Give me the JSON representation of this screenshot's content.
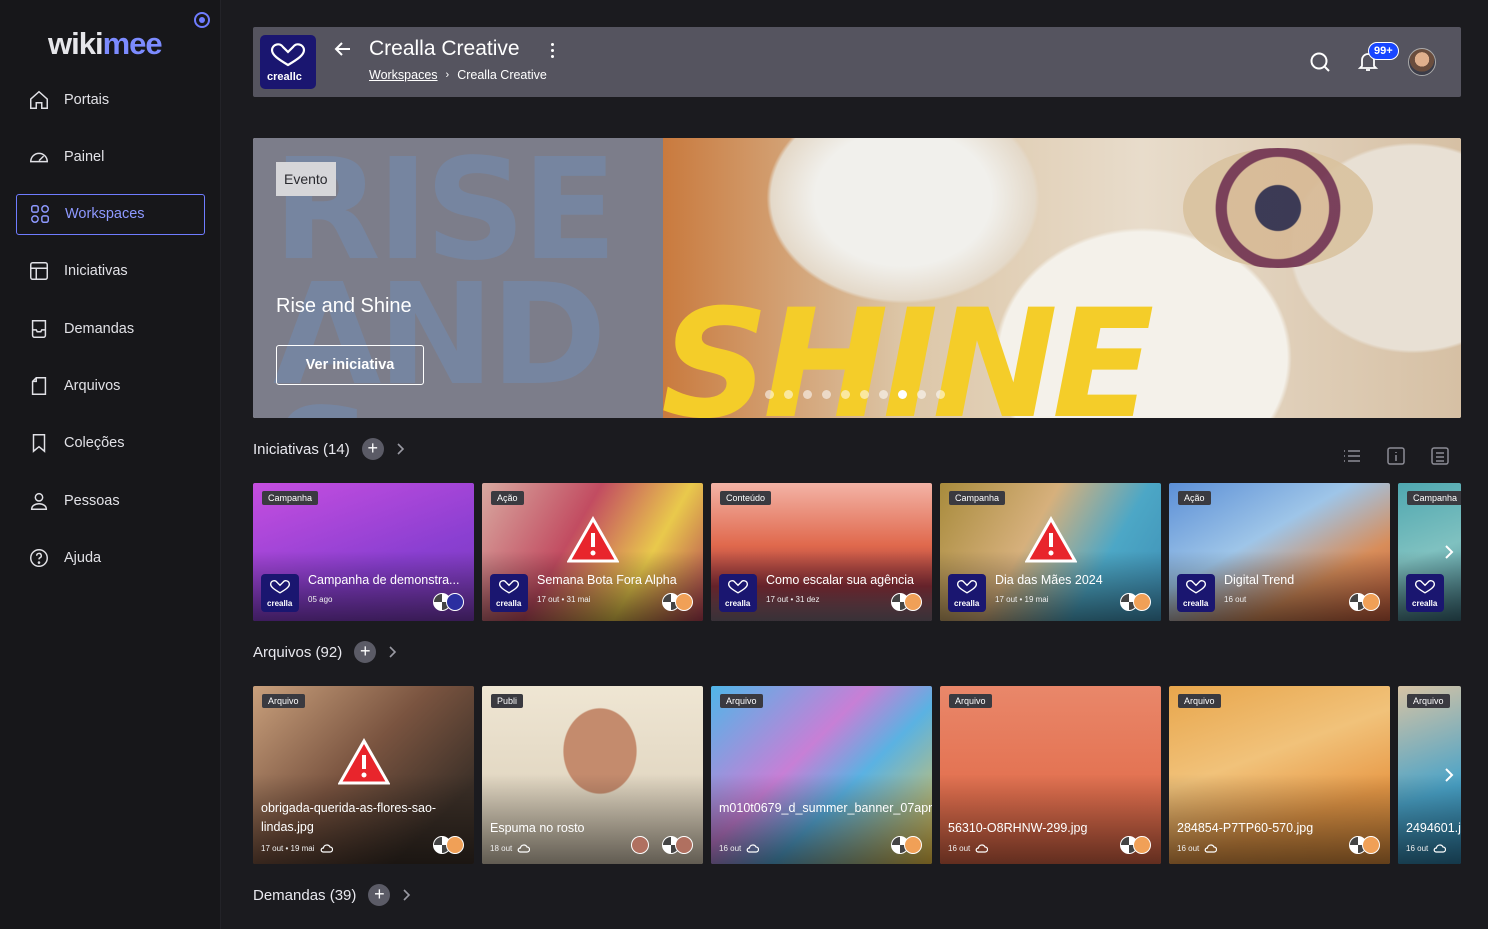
{
  "sidebar": {
    "logo_part1": "wiki",
    "logo_part2": "mee",
    "items": [
      {
        "label": "Portais",
        "icon": "home-icon"
      },
      {
        "label": "Painel",
        "icon": "gauge-icon"
      },
      {
        "label": "Workspaces",
        "icon": "grid-icon",
        "active": true
      },
      {
        "label": "Iniciativas",
        "icon": "layout-icon"
      },
      {
        "label": "Demandas",
        "icon": "inbox-icon"
      },
      {
        "label": "Arquivos",
        "icon": "file-icon"
      },
      {
        "label": "Coleções",
        "icon": "bookmark-icon"
      },
      {
        "label": "Pessoas",
        "icon": "user-icon"
      },
      {
        "label": "Ajuda",
        "icon": "help-icon"
      }
    ]
  },
  "header": {
    "workspace_title": "Crealla Creative",
    "workspace_logo_text": "creallc",
    "breadcrumb_link": "Workspaces",
    "breadcrumb_current": "Crealla Creative",
    "notifications_count": "99+"
  },
  "banner": {
    "tag": "Evento",
    "title": "Rise and Shine",
    "button": "Ver iniciativa",
    "ghost_text": "RISE AND S",
    "shine_text": "SHINE",
    "dots_total": 10,
    "dots_active": 8
  },
  "iniciativas": {
    "label": "Iniciativas",
    "count": "(14)",
    "cards": [
      {
        "tag": "Campanha",
        "title": "Campanha de demonstra...",
        "date": "05 ago",
        "warning": false
      },
      {
        "tag": "Ação",
        "title": "Semana Bota Fora Alpha",
        "date": "17 out  •  31 mai",
        "warning": true
      },
      {
        "tag": "Conteúdo",
        "title": "Como escalar sua agência",
        "date": "17 out  •  31 dez",
        "warning": false
      },
      {
        "tag": "Campanha",
        "title": "Dia das Mães 2024",
        "date": "17 out  •  19 mai",
        "warning": true
      },
      {
        "tag": "Ação",
        "title": "Digital Trend",
        "date": "16 out",
        "warning": false
      },
      {
        "tag": "Campanha",
        "title": "",
        "date": "",
        "warning": false
      }
    ]
  },
  "arquivos": {
    "label": "Arquivos",
    "count": "(92)",
    "cards": [
      {
        "tag": "Arquivo",
        "title": "obrigada-querida-as-flores-sao-lindas.jpg",
        "date": "17 out  •  19 mai",
        "warning": true
      },
      {
        "tag": "Publi",
        "title": "Espuma no rosto",
        "date": "18 out",
        "warning": false
      },
      {
        "tag": "Arquivo",
        "title": "m010t0679_d_summer_banner_07apr23.jpg",
        "date": "16 out",
        "warning": false
      },
      {
        "tag": "Arquivo",
        "title": "56310-O8RHNW-299.jpg",
        "date": "16 out",
        "warning": false
      },
      {
        "tag": "Arquivo",
        "title": "284854-P7TP60-570.jpg",
        "date": "16 out",
        "warning": false
      },
      {
        "tag": "Arquivo",
        "title": "2494601.j",
        "date": "16 out",
        "warning": false
      }
    ]
  },
  "demandas": {
    "label": "Demandas",
    "count": "(39)"
  },
  "colors": {
    "accent": "#6f7cff",
    "sidebar_bg": "#17171a",
    "page_bg": "#1b1b1f",
    "header_bg": "#55545f",
    "badge": "#1846ff"
  }
}
